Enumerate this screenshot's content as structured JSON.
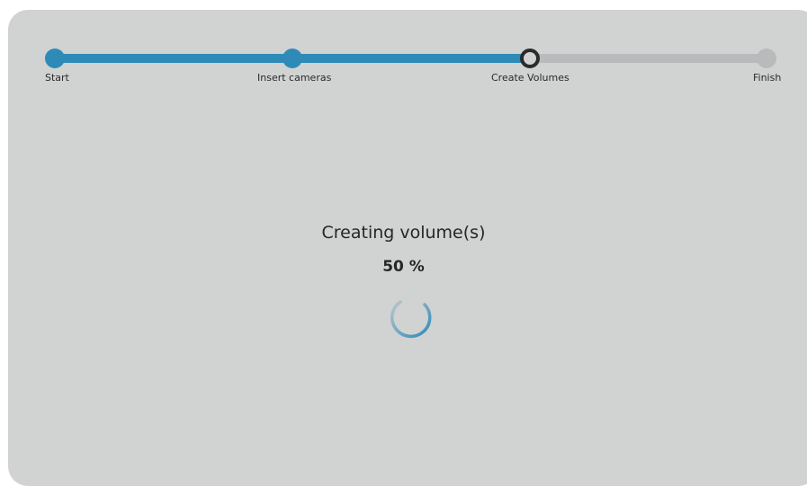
{
  "wizard": {
    "steps": [
      {
        "label": "Start",
        "state": "done"
      },
      {
        "label": "Insert cameras",
        "state": "done"
      },
      {
        "label": "Create Volumes",
        "state": "current"
      },
      {
        "label": "Finish",
        "state": "todo"
      }
    ],
    "colors": {
      "accent": "#2e8bb8",
      "inactive": "#b9babb",
      "panel": "#d1d2d2",
      "current_ring": "#2b2b2b"
    }
  },
  "progress": {
    "title": "Creating volume(s)",
    "percent_text": "50 %",
    "value": 0.5,
    "spinner_icon": "loading-spinner-icon"
  }
}
